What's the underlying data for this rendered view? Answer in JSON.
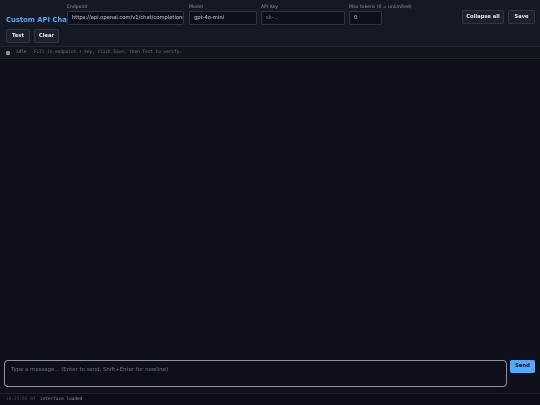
{
  "header": {
    "app_title": "Custom API Chat",
    "endpoint": {
      "label": "Endpoint",
      "value": "https://api.openai.com/v1/chat/completions"
    },
    "model": {
      "label": "Model",
      "value": "gpt-4o-mini"
    },
    "api_key": {
      "label": "API Key",
      "value": "",
      "placeholder": "sk-..."
    },
    "max_tokens": {
      "label": "Max tokens (0 = unlimited)",
      "value": "0"
    },
    "collapse_label": "Collapse all",
    "save_label": "Save",
    "test_label": "Test",
    "clear_label": "Clear"
  },
  "status": {
    "state": "idle",
    "hint": "Fill in endpoint + key, click Save, then Test to verify."
  },
  "composer": {
    "placeholder": "Type a message... (Enter to send, Shift+Enter for newline)",
    "send_label": "Send"
  },
  "log": {
    "time": "18:25:50 AM",
    "message": "interface loaded"
  },
  "colors": {
    "accent": "#58a6ff",
    "background": "#0e1117"
  }
}
